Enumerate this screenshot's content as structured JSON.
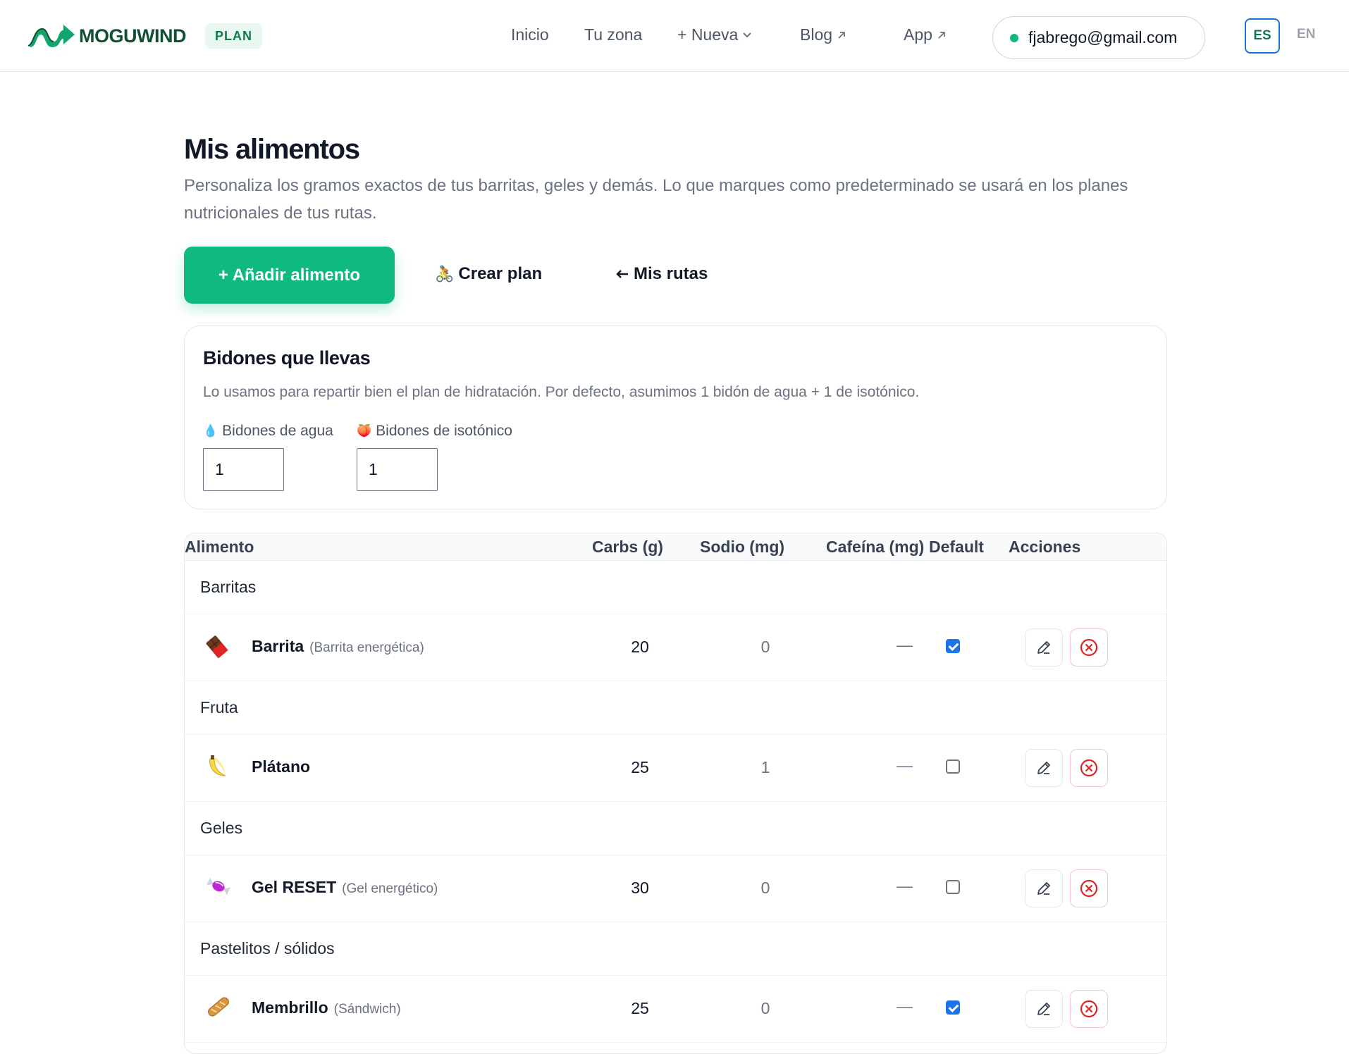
{
  "header": {
    "brand": "MOGUWIND",
    "badge": "PLAN",
    "nav": {
      "inicio": "Inicio",
      "tu_zona": "Tu zona",
      "nueva": "+ Nueva",
      "blog": "Blog",
      "app": "App"
    },
    "user_email": "fjabrego@gmail.com",
    "lang_es": "ES",
    "lang_en": "EN"
  },
  "page": {
    "title": "Mis alimentos",
    "description": "Personaliza los gramos exactos de tus barritas, geles y demás. Lo que marques como predeterminado se usará en los planes nutricionales de tus rutas.",
    "add_button": "+ Añadir alimento",
    "create_plan": "Crear plan",
    "my_routes": "Mis rutas"
  },
  "bottles": {
    "title": "Bidones que llevas",
    "description": "Lo usamos para repartir bien el plan de hidratación. Por defecto, asumimos 1 bidón de agua + 1 de isotónico.",
    "water_label": "Bidones de agua",
    "water_value": "1",
    "iso_label": "Bidones de isotónico",
    "iso_value": "1"
  },
  "table": {
    "columns": {
      "food": "Alimento",
      "carbs": "Carbs (g)",
      "sodium": "Sodio (mg)",
      "caffeine": "Cafeína (mg)",
      "default": "Default",
      "actions": "Acciones"
    },
    "groups": [
      {
        "name": "Barritas",
        "item": {
          "icon": "chocolate-bar-icon",
          "name": "Barrita",
          "sub": "(Barrita energética)",
          "carbs": "20",
          "sodium": "0",
          "caffeine": "—",
          "default": true
        }
      },
      {
        "name": "Fruta",
        "item": {
          "icon": "banana-icon",
          "name": "Plátano",
          "sub": "",
          "carbs": "25",
          "sodium": "1",
          "caffeine": "—",
          "default": false
        }
      },
      {
        "name": "Geles",
        "item": {
          "icon": "candy-icon",
          "name": "Gel RESET",
          "sub": "(Gel energético)",
          "carbs": "30",
          "sodium": "0",
          "caffeine": "—",
          "default": false
        }
      },
      {
        "name": "Pastelitos / sólidos",
        "item": {
          "icon": "baguette-icon",
          "name": "Membrillo",
          "sub": "(Sándwich)",
          "carbs": "25",
          "sodium": "0",
          "caffeine": "—",
          "default": true
        }
      }
    ]
  },
  "colors": {
    "accent": "#10b981",
    "brand_dark": "#0f5132",
    "danger": "#dc2626",
    "checkbox": "#1a73e8"
  }
}
